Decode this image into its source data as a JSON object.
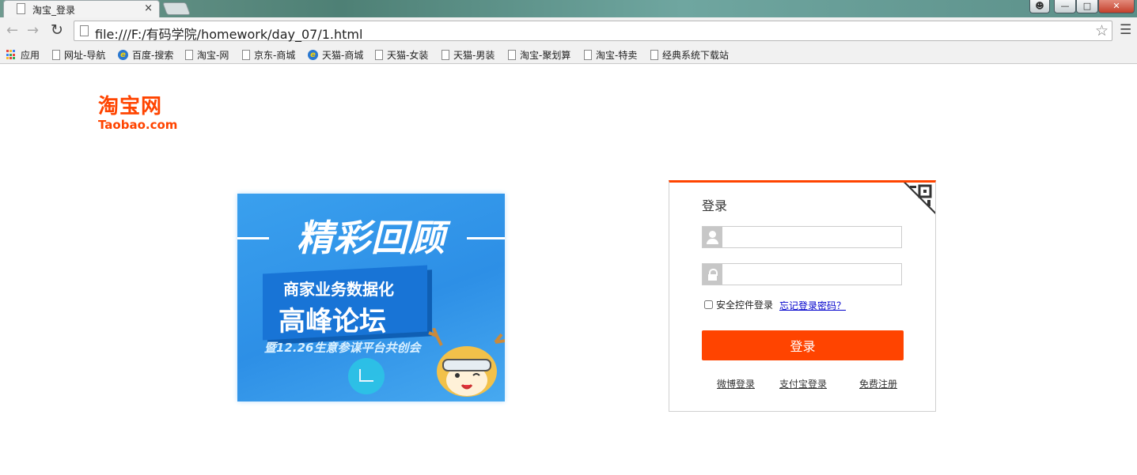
{
  "browser": {
    "tab_title": "淘宝_登录",
    "tab_close": "×",
    "url": "file:///F:/有码学院/homework/day_07/1.html",
    "bookmarks": [
      {
        "label": "应用",
        "icon": "apps-icon"
      },
      {
        "label": "网址-导航",
        "icon": "page-icon"
      },
      {
        "label": "百度-搜索",
        "icon": "ie-icon"
      },
      {
        "label": "淘宝-网",
        "icon": "page-icon"
      },
      {
        "label": "京东-商城",
        "icon": "page-icon"
      },
      {
        "label": "天猫-商城",
        "icon": "ie-icon"
      },
      {
        "label": "天猫-女装",
        "icon": "page-icon"
      },
      {
        "label": "天猫-男装",
        "icon": "page-icon"
      },
      {
        "label": "淘宝-聚划算",
        "icon": "page-icon"
      },
      {
        "label": "淘宝-特卖",
        "icon": "page-icon"
      },
      {
        "label": "经典系统下载站",
        "icon": "page-icon"
      }
    ]
  },
  "logo": {
    "cn": "淘宝网",
    "en": "Taobao.com",
    "color": "#ff4400"
  },
  "banner": {
    "headline": "精彩回顾",
    "line1": "商家业务数据化",
    "line2": "高峰论坛",
    "line3": "暨12.26生意参谋平台共创会"
  },
  "login": {
    "title": "登录",
    "username_value": "",
    "password_value": "",
    "security_checkbox_label": "安全控件登录",
    "forgot_link": "忘记登录密码？",
    "submit_label": "登录",
    "links": {
      "weibo": "微博登录",
      "alipay": "支付宝登录",
      "register": "免费注册"
    },
    "accent_color": "#ff4400"
  }
}
